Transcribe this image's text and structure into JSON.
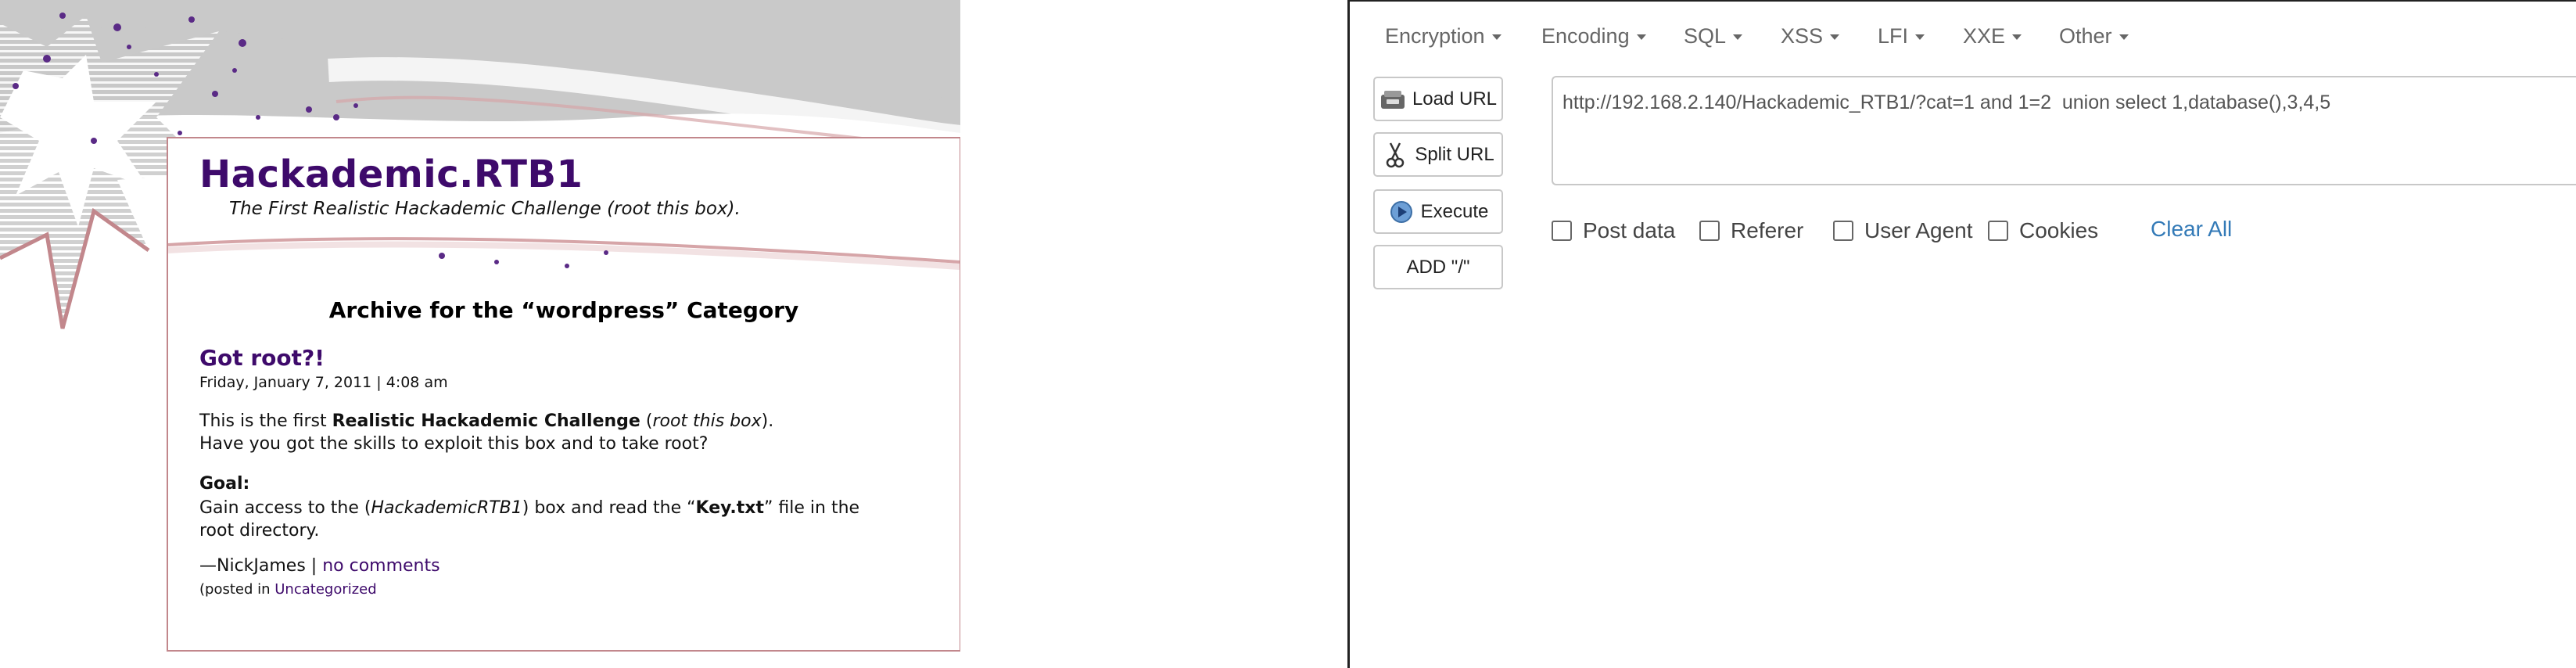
{
  "blog": {
    "site_title": "Hackademic.RTB1",
    "site_description": "The First Realistic Hackademic Challenge (root this box).",
    "archive_title": "Archive for the “wordpress” Category",
    "post": {
      "title": "Got root?!",
      "date": "Friday, January 7, 2011 | 4:08 am",
      "intro_prefix": "This is the first ",
      "intro_bold": "Realistic Hackademic Challenge",
      "intro_mid": " (",
      "intro_italic": "root this box",
      "intro_suffix": ").",
      "line2": "Have you got the skills to exploit this box and to take root?",
      "goal_label": "Goal:",
      "goal_prefix": "Gain access to the (",
      "goal_italic": "HackademicRTB1",
      "goal_mid": ") box and read the “",
      "goal_bold": "Key.txt",
      "goal_suffix": "” file in the",
      "goal_line2": "root directory.",
      "author": "—NickJames | ",
      "comments_link": "no comments",
      "posted_prefix": "(posted in ",
      "category_link": "Uncategorized"
    }
  },
  "hackbar": {
    "menus": [
      {
        "label": "Encryption"
      },
      {
        "label": "Encoding"
      },
      {
        "label": "SQL"
      },
      {
        "label": "XSS"
      },
      {
        "label": "LFI"
      },
      {
        "label": "XXE"
      },
      {
        "label": "Other"
      }
    ],
    "buttons": {
      "load_url": "Load URL",
      "split_url": "Split URL",
      "execute": "Execute",
      "add_slash": "ADD \"/\""
    },
    "url_value": "http://192.168.2.140/Hackademic_RTB1/?cat=1 and 1=2  union select 1,database(),3,4,5",
    "checkboxes": {
      "post_data": "Post data",
      "referer": "Referer",
      "user_agent": "User Agent",
      "cookies": "Cookies"
    },
    "clear_all": "Clear All"
  },
  "colors": {
    "title_purple": "#3e0a6b",
    "link_blue": "#337ab7",
    "card_border": "#c2878c",
    "bg_gray": "#c9c9c9"
  }
}
